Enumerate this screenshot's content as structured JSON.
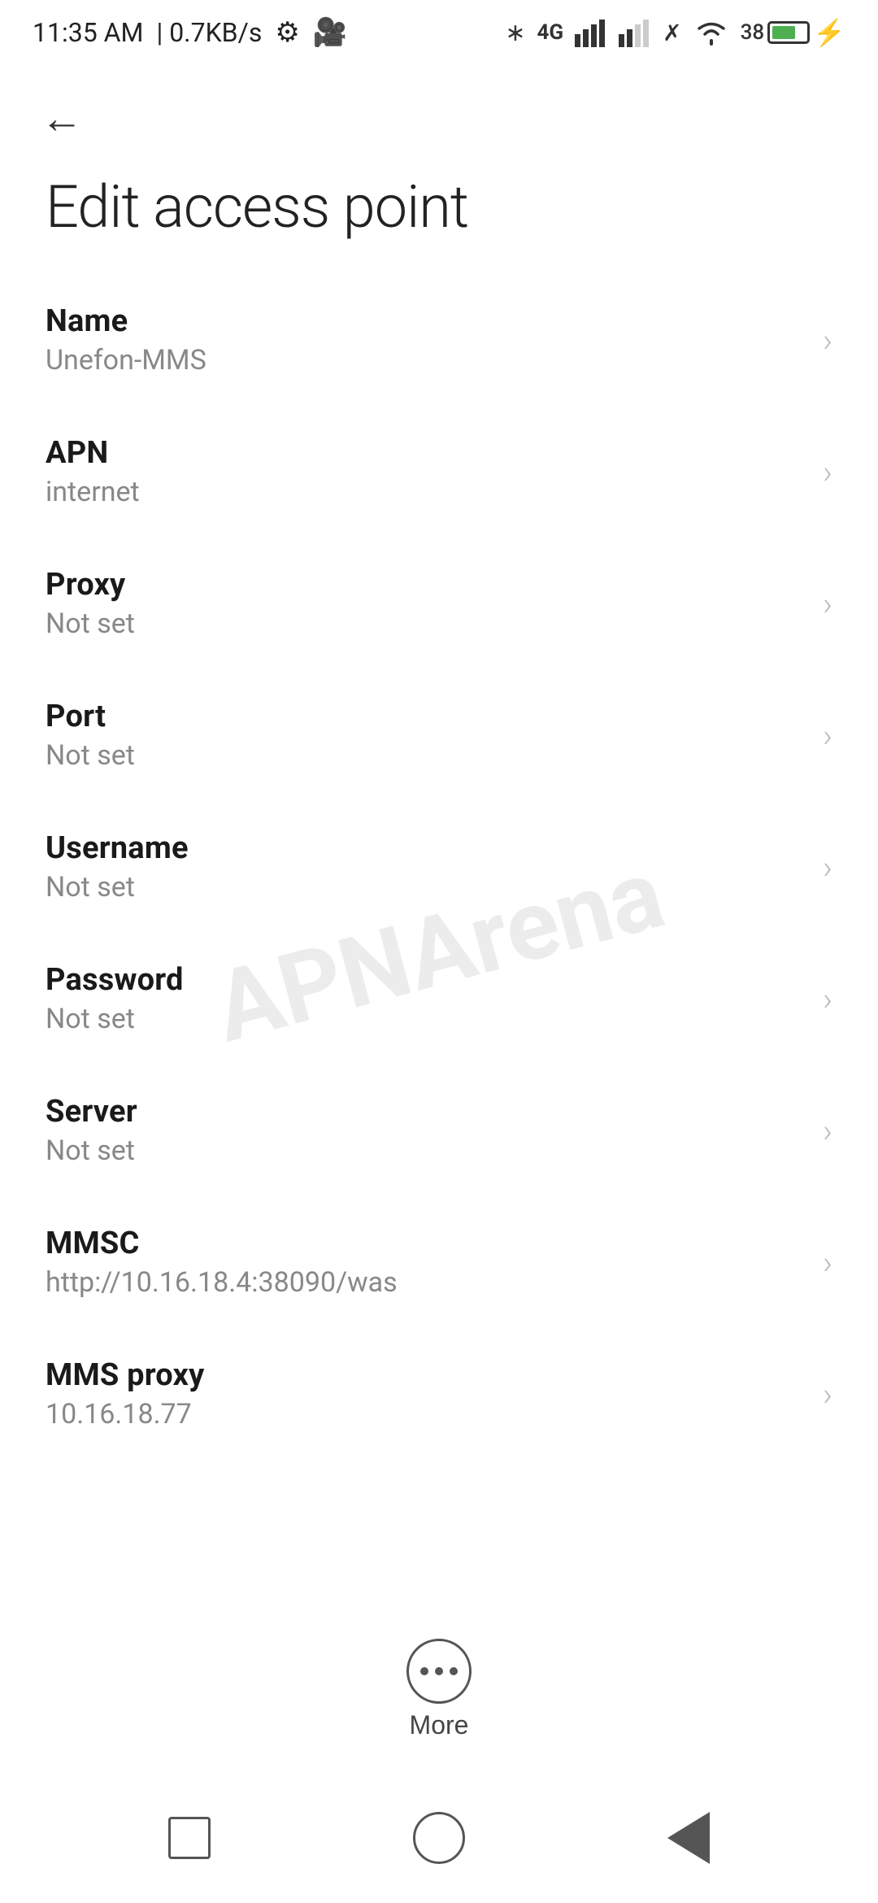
{
  "status_bar": {
    "time": "11:35 AM",
    "speed": "0.7KB/s"
  },
  "page": {
    "title": "Edit access point",
    "back_label": "←"
  },
  "settings_items": [
    {
      "label": "Name",
      "value": "Unefon-MMS"
    },
    {
      "label": "APN",
      "value": "internet"
    },
    {
      "label": "Proxy",
      "value": "Not set"
    },
    {
      "label": "Port",
      "value": "Not set"
    },
    {
      "label": "Username",
      "value": "Not set"
    },
    {
      "label": "Password",
      "value": "Not set"
    },
    {
      "label": "Server",
      "value": "Not set"
    },
    {
      "label": "MMSC",
      "value": "http://10.16.18.4:38090/was"
    },
    {
      "label": "MMS proxy",
      "value": "10.16.18.77"
    }
  ],
  "more_button": {
    "label": "More"
  },
  "battery": {
    "level": "38",
    "percentage": "38%"
  }
}
